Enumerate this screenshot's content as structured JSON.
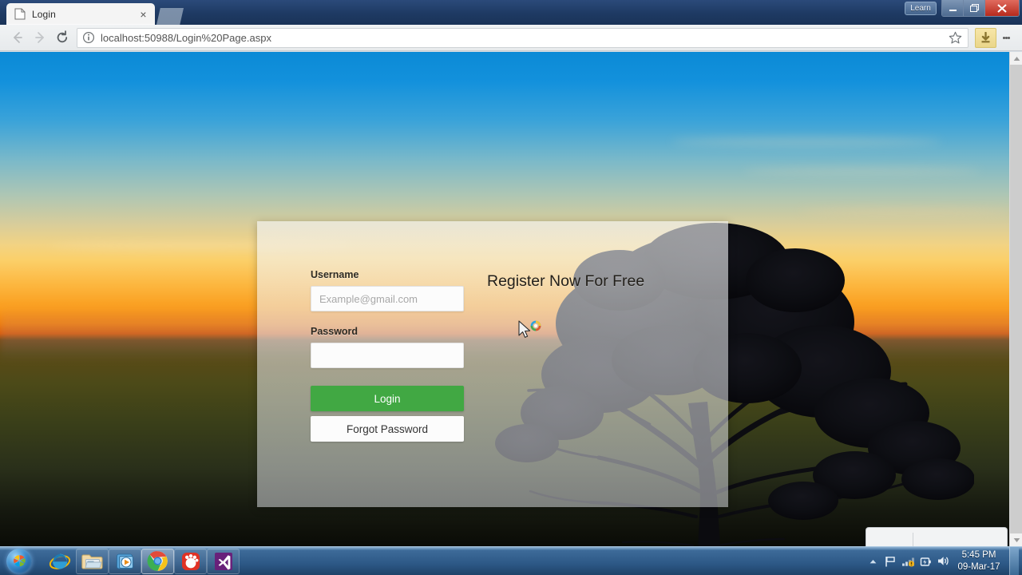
{
  "browser": {
    "tab": {
      "title": "Login",
      "favicon": "page-icon",
      "close_label": "×"
    },
    "new_tab_label": "",
    "window_controls": {
      "learn_label": "Learn",
      "minimize_label": "Minimize",
      "maximize_label": "Restore",
      "close_label": "Close"
    },
    "toolbar": {
      "back_label": "Back",
      "forward_label": "Forward",
      "reload_label": "Reload",
      "url_host": "localhost:50988",
      "url_path": "/Login%20Page.aspx",
      "url_full": "localhost:50988/Login%20Page.aspx",
      "info_icon": "info-circle-icon",
      "bookmark_icon": "star-icon",
      "download_icon": "download-arrow-icon",
      "menu_icon": "three-dots-menu-icon"
    },
    "download_shelf": {
      "visible": true
    }
  },
  "page": {
    "form": {
      "username_label": "Username",
      "username_value": "",
      "username_placeholder": "Example@gmail.com",
      "password_label": "Password",
      "password_value": "",
      "password_placeholder": "",
      "login_button": "Login",
      "forgot_button": "Forgot Password"
    },
    "register_text": "Register Now For Free",
    "colors": {
      "login_green": "#41a843",
      "card_overlay": "rgba(242,244,247,0.58)",
      "sky_top": "#0b8ad6",
      "sky_gold": "#fcb740",
      "sky_orange": "#f07c06",
      "ground_dark": "#0a0b06"
    },
    "cursor": "arrow-with-busy-spinner"
  },
  "taskbar": {
    "start_label": "Start",
    "items": [
      {
        "name": "internet-explorer",
        "label": "Internet Explorer"
      },
      {
        "name": "windows-explorer",
        "label": "File Explorer"
      },
      {
        "name": "windows-media-player",
        "label": "Windows Media Player"
      },
      {
        "name": "google-chrome",
        "label": "Google Chrome"
      },
      {
        "name": "potplayer",
        "label": "PotPlayer"
      },
      {
        "name": "visual-studio",
        "label": "Visual Studio"
      }
    ],
    "tray": {
      "show_hidden_icon": "chevron-up-icon",
      "action_center_icon": "flag-icon",
      "network_icon": "network-icon",
      "power_icon": "battery-icon",
      "volume_icon": "speaker-icon",
      "time": "5:45 PM",
      "date": "09-Mar-17"
    }
  }
}
